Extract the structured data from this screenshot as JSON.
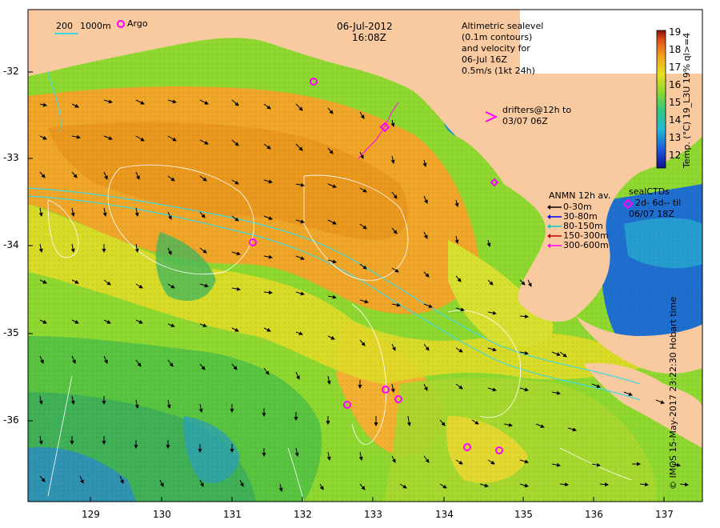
{
  "header": {
    "date": "06-Jul-2012",
    "time": "16:08Z"
  },
  "scale_legend": {
    "depth_200": "200",
    "depth_1000": "1000m",
    "argo_label": "Argo"
  },
  "altimetry_note": {
    "line1": "Altimetric sealevel",
    "line2": "(0.1m contours)",
    "line3": "and velocity for",
    "line4": "06-Jul 16Z",
    "line5": "0.5m/s (1kt 24h)"
  },
  "drifters_note": {
    "line1": "drifters@12h to",
    "line2": "03/07 06Z"
  },
  "anmn_legend": {
    "title": "ANMN 12h av.",
    "items": [
      {
        "label": "0-30m",
        "color": "#000000"
      },
      {
        "label": "30-80m",
        "color": "#0000ff"
      },
      {
        "label": "80-150m",
        "color": "#00cccc"
      },
      {
        "label": "150-300m",
        "color": "#cc0000"
      },
      {
        "label": "300-600m",
        "color": "#ff00ff"
      }
    ]
  },
  "sealctd_legend": {
    "title": "sealCTDs",
    "line2": "2d- 6d-- til",
    "line3": "06/07 18Z"
  },
  "colorbar": {
    "label": "Temp. (°C) 19_L3U 19% ql>=4",
    "ticks": [
      "19",
      "18",
      "17",
      "16",
      "15",
      "14",
      "13",
      "12"
    ],
    "min": 11.5,
    "max": 19.2
  },
  "axes": {
    "lat_ticks": [
      "-32",
      "-33",
      "-34",
      "-35",
      "-36"
    ],
    "lon_ticks": [
      "129",
      "130",
      "131",
      "132",
      "133",
      "134",
      "135",
      "136",
      "137"
    ]
  },
  "footer": "© IMOS 15-May-2017 23:22:30 Hobart time",
  "colors": {
    "land": "#f9c9a0",
    "warm": "#f4a020",
    "mid": "#e8e020",
    "cool": "#4cc840",
    "cold": "#2080d0",
    "argo": "#ff00ff"
  }
}
